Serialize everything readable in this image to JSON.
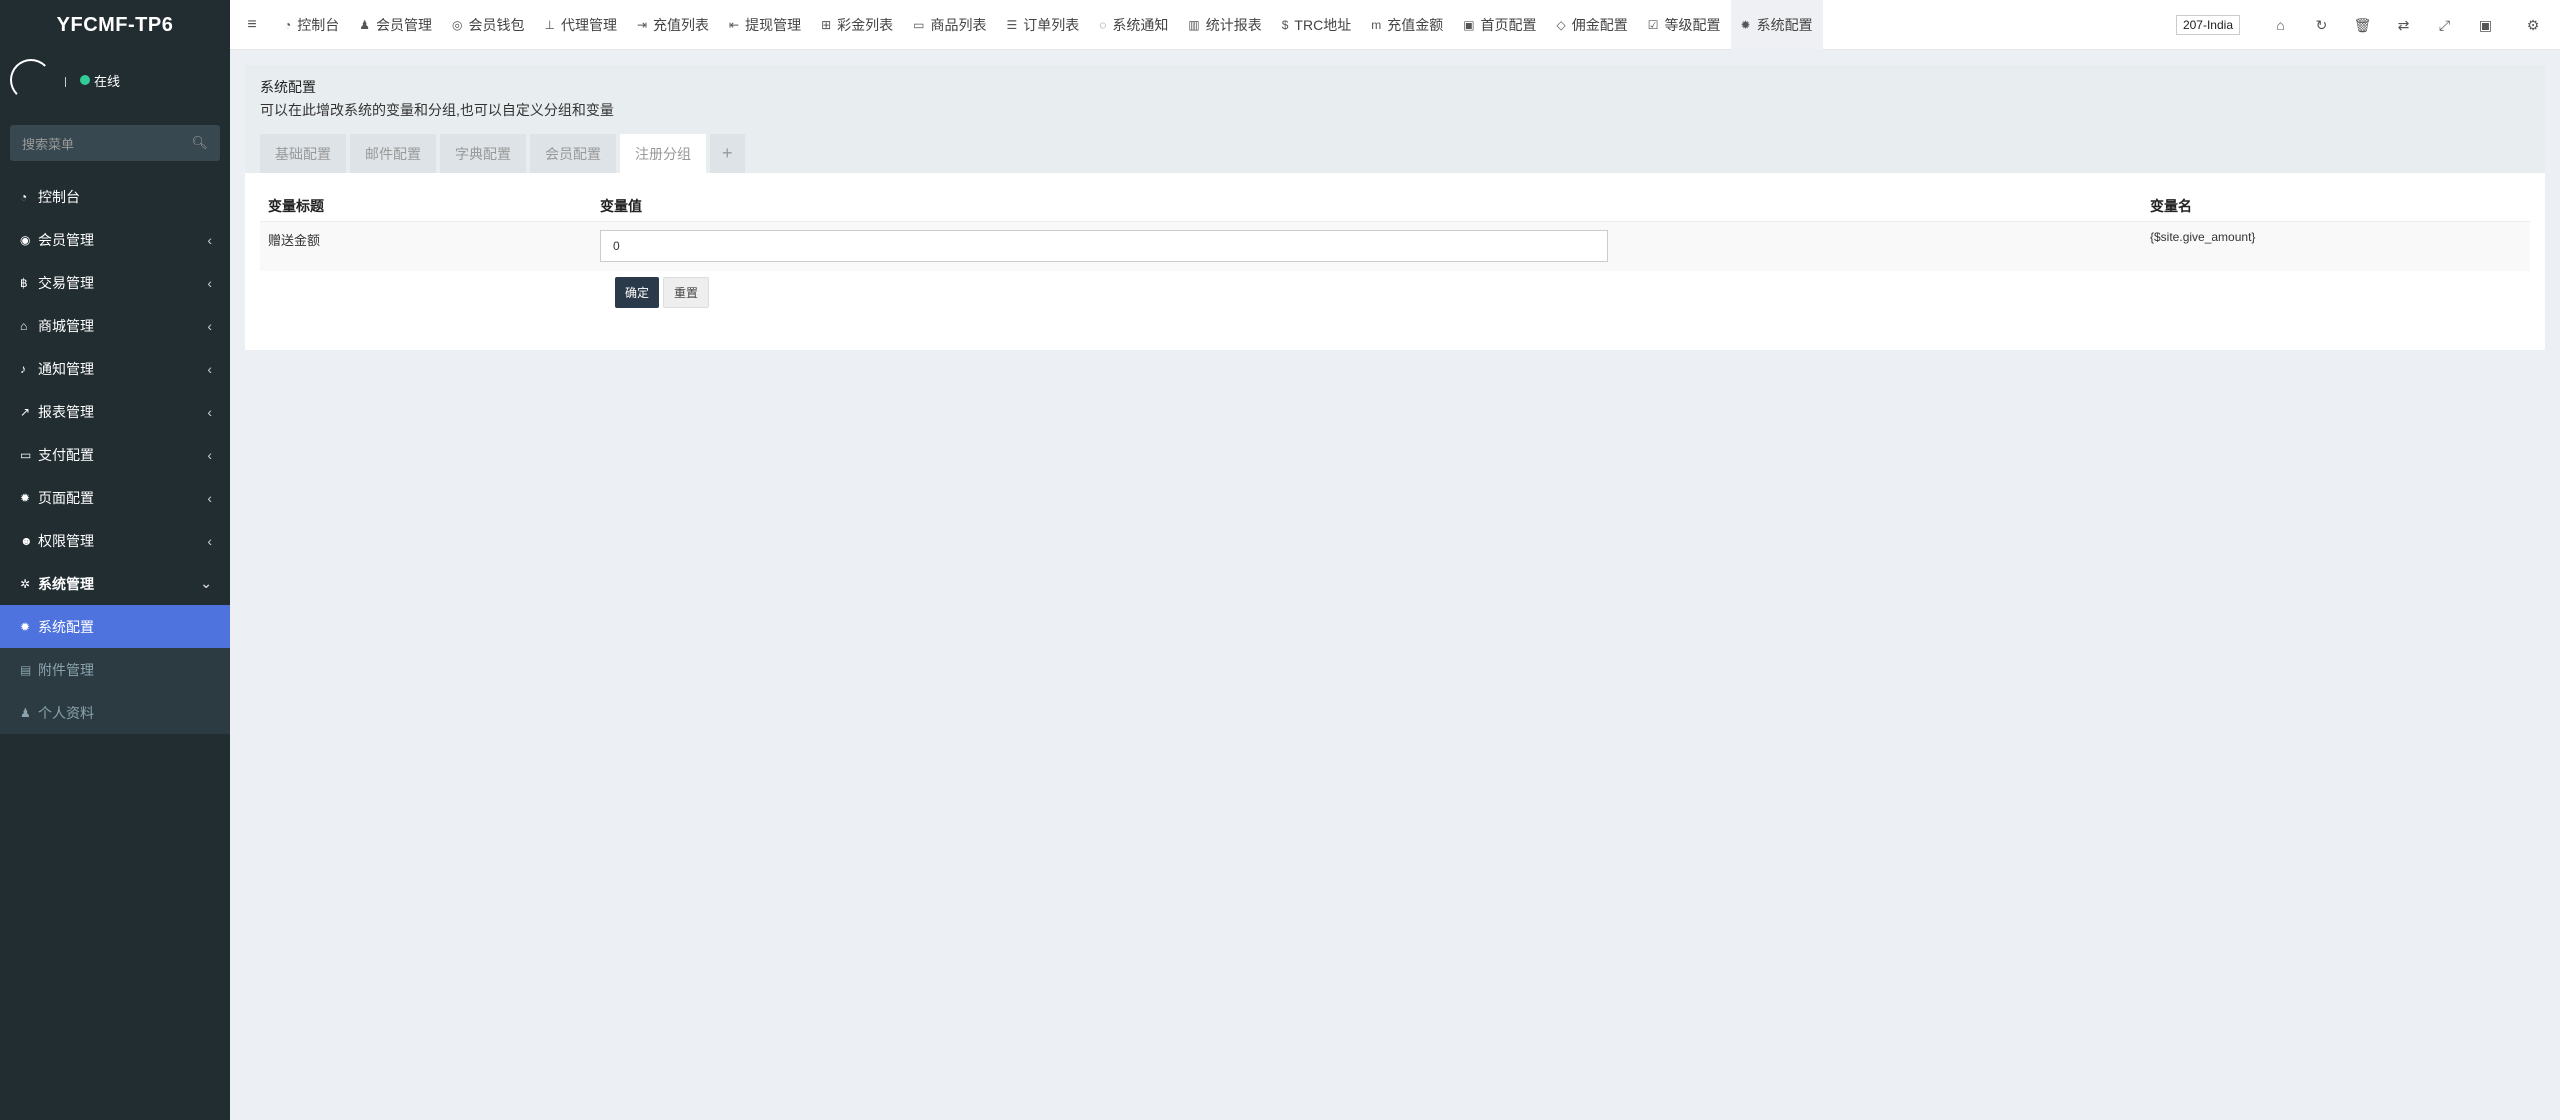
{
  "app": {
    "logo": "YFCMF-TP6"
  },
  "user": {
    "status": "在线"
  },
  "search": {
    "placeholder": "搜索菜单"
  },
  "sidebar": {
    "items": [
      {
        "label": "控制台",
        "icon": "dashboard-icon"
      },
      {
        "label": "会员管理",
        "icon": "user-circle-icon"
      },
      {
        "label": "交易管理",
        "icon": "bitcoin-icon"
      },
      {
        "label": "商城管理",
        "icon": "home-icon"
      },
      {
        "label": "通知管理",
        "icon": "bell-icon"
      },
      {
        "label": "报表管理",
        "icon": "line-chart-icon"
      },
      {
        "label": "支付配置",
        "icon": "credit-card-icon"
      },
      {
        "label": "页面配置",
        "icon": "gear-icon"
      },
      {
        "label": "权限管理",
        "icon": "users-icon"
      },
      {
        "label": "系统管理",
        "icon": "gears-icon"
      }
    ],
    "submenu": [
      {
        "label": "系统配置",
        "icon": "gear-icon"
      },
      {
        "label": "附件管理",
        "icon": "file-image-icon"
      },
      {
        "label": "个人资料",
        "icon": "user-icon"
      }
    ]
  },
  "topbar": {
    "tabs": [
      {
        "label": "控制台",
        "icon": "dashboard-icon"
      },
      {
        "label": "会员管理",
        "icon": "user-icon"
      },
      {
        "label": "会员钱包",
        "icon": "wallet-icon"
      },
      {
        "label": "代理管理",
        "icon": "sitemap-icon"
      },
      {
        "label": "充值列表",
        "icon": "sign-in-icon"
      },
      {
        "label": "提现管理",
        "icon": "sign-out-icon"
      },
      {
        "label": "彩金列表",
        "icon": "gift-icon"
      },
      {
        "label": "商品列表",
        "icon": "desktop-icon"
      },
      {
        "label": "订单列表",
        "icon": "list-icon"
      },
      {
        "label": "系统通知",
        "icon": "comments-icon"
      },
      {
        "label": "统计报表",
        "icon": "bar-chart-icon"
      },
      {
        "label": "TRC地址",
        "icon": "dollar-icon"
      },
      {
        "label": "充值金额",
        "icon": "money-icon"
      },
      {
        "label": "首页配置",
        "icon": "list-alt-icon"
      },
      {
        "label": "佣金配置",
        "icon": "diamond-icon"
      },
      {
        "label": "等级配置",
        "icon": "check-square-icon"
      },
      {
        "label": "系统配置",
        "icon": "gear-icon"
      }
    ],
    "site": "207-India"
  },
  "config": {
    "title": "系统配置",
    "description": "可以在此增改系统的变量和分组,也可以自定义分组和变量",
    "tabs": [
      "基础配置",
      "邮件配置",
      "字典配置",
      "会员配置",
      "注册分组"
    ],
    "add_tab": "+",
    "table": {
      "headers": [
        "变量标题",
        "变量值",
        "变量名"
      ],
      "rows": [
        {
          "title": "赠送金额",
          "value": "0",
          "name": "{$site.give_amount}"
        }
      ]
    },
    "submit_label": "确定",
    "reset_label": "重置"
  }
}
